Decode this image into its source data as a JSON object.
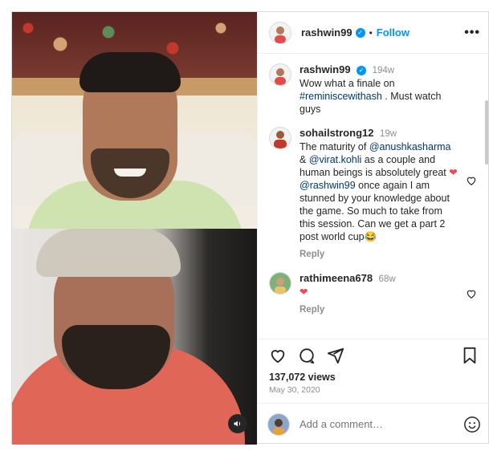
{
  "post": {
    "username": "rashwin99",
    "follow_label": "Follow",
    "more_label": "•••",
    "caption": {
      "username": "rashwin99",
      "time": "194w",
      "text_before": "Wow what a finale on ",
      "hashtag": "#reminiscewithash",
      "text_after": " . Must watch guys"
    },
    "comments": [
      {
        "username": "sohailstrong12",
        "time": "19w",
        "parts": [
          {
            "t": "The maturity of ",
            "k": "text"
          },
          {
            "t": "@anushkasharma",
            "k": "link"
          },
          {
            "t": " & ",
            "k": "text"
          },
          {
            "t": "@virat.kohli",
            "k": "link"
          },
          {
            "t": " as a couple and human beings is absolutely great ",
            "k": "text"
          },
          {
            "t": "❤",
            "k": "heart"
          },
          {
            "t": " ",
            "k": "text"
          },
          {
            "t": "@rashwin99",
            "k": "link"
          },
          {
            "t": " once again I am stunned by your knowledge about the game. So much to take from this session. Can we get a part 2 post world cup",
            "k": "text"
          },
          {
            "t": "😂",
            "k": "text"
          }
        ],
        "reply_label": "Reply"
      },
      {
        "username": "rathimeena678",
        "time": "68w",
        "parts": [
          {
            "t": "❤",
            "k": "heart"
          }
        ],
        "reply_label": "Reply"
      }
    ],
    "views": "137,072 views",
    "date": "May 30, 2020",
    "add_comment_placeholder": "Add a comment…"
  },
  "icons": {
    "verified": "verified-badge-icon",
    "like": "heart-icon",
    "comment": "comment-icon",
    "share": "share-icon",
    "save": "bookmark-icon",
    "emoji": "emoji-icon",
    "sound": "sound-icon"
  },
  "colors": {
    "accent": "#0095f6",
    "link": "#00376b",
    "muted": "#8e8e8e",
    "heart": "#ed4956"
  }
}
